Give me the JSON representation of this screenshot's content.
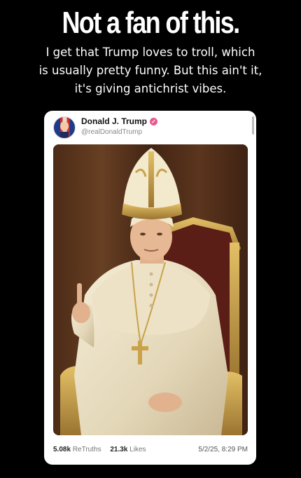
{
  "headline": "Not a fan of this.",
  "subtitle": [
    "I get that Trump loves to troll, which",
    "is usually pretty funny. But this ain't it,",
    "it's giving antichrist vibes."
  ],
  "post": {
    "author": "Donald J. Trump",
    "handle": "@realDonaldTrump",
    "verified_icon": "verified-badge-icon",
    "retruths_count": "5.08k",
    "retruths_label": "ReTruths",
    "likes_count": "21.3k",
    "likes_label": "Likes",
    "timestamp": "5/2/25, 8:29 PM"
  },
  "colors": {
    "background": "#000000",
    "card": "#ffffff",
    "verified": "#e8588f"
  }
}
